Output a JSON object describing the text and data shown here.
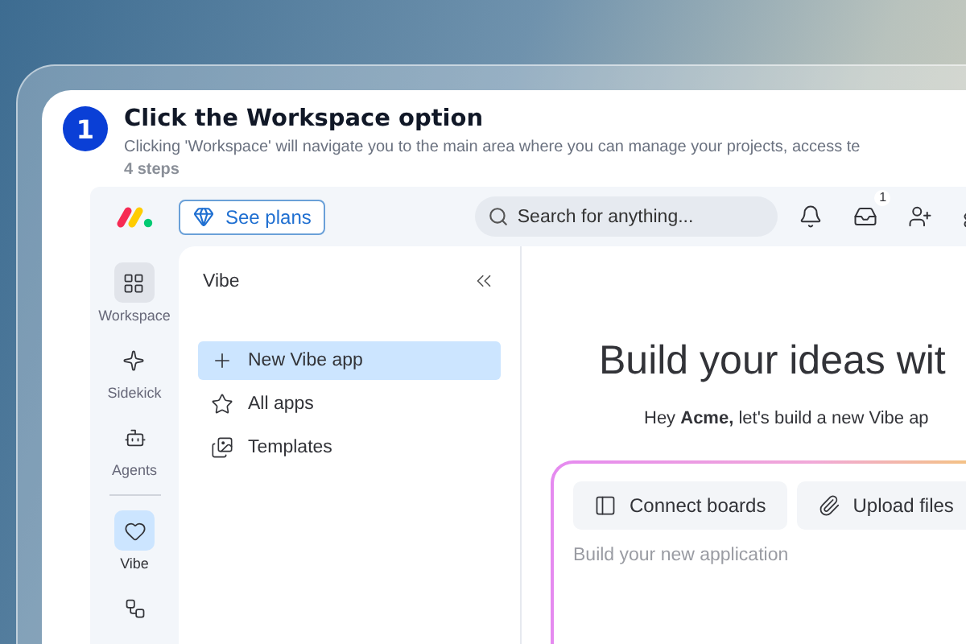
{
  "step": {
    "number": "1",
    "title": "Click the Workspace option",
    "description": "Clicking 'Workspace' will navigate you to the main area where you can manage your projects, access te",
    "count": "4 steps"
  },
  "topbar": {
    "plans_button": "See plans",
    "search": {
      "placeholder": "Search for anything..."
    },
    "inbox_badge": "1"
  },
  "rail": {
    "top": [
      {
        "label": "Workspace",
        "kind": "workspace",
        "selected": false,
        "hovered": true
      },
      {
        "label": "Sidekick",
        "kind": "sidekick",
        "selected": false,
        "hovered": false
      },
      {
        "label": "Agents",
        "kind": "agents",
        "selected": false,
        "hovered": false
      }
    ],
    "bottom": [
      {
        "label": "Vibe",
        "kind": "vibe",
        "selected": true,
        "hovered": false
      },
      {
        "kind": "workflows",
        "selected": false,
        "hovered": false
      }
    ]
  },
  "panel": {
    "title": "Vibe",
    "items": [
      {
        "label": "New Vibe app",
        "kind": "new",
        "selected": true
      },
      {
        "label": "All apps",
        "kind": "all",
        "selected": false
      },
      {
        "label": "Templates",
        "kind": "templates",
        "selected": false
      }
    ]
  },
  "main": {
    "heading": "Build your ideas wit",
    "subtitle": "Hey **Acme,** let's build a new Vibe ap",
    "prompt": {
      "actions": [
        {
          "label": "Connect boards",
          "kind": "boards"
        },
        {
          "label": "Upload files",
          "kind": "upload"
        }
      ],
      "placeholder": "Build your new application"
    }
  }
}
